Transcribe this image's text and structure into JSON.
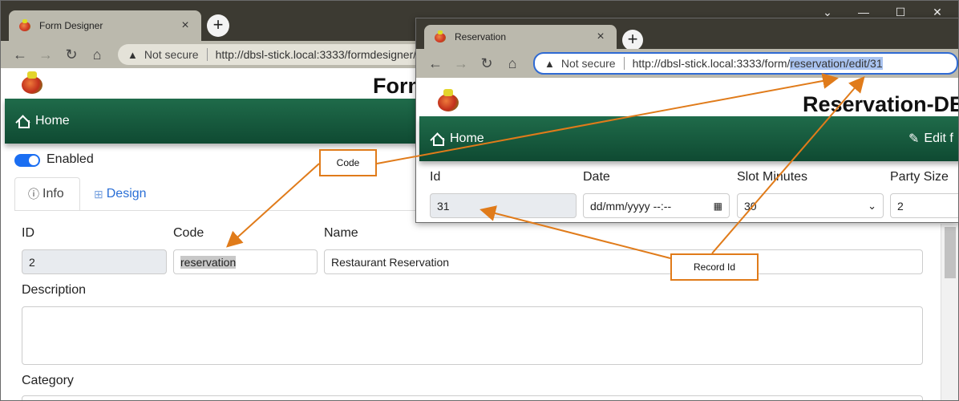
{
  "window1": {
    "tab_title": "Form Designer",
    "not_secure": "Not secure",
    "url": "http://dbsl-stick.local:3333/formdesigner/",
    "page_title": "Form",
    "home": "Home",
    "enabled": "Enabled",
    "tabs": [
      "Info",
      "Design"
    ],
    "labels": {
      "id": "ID",
      "code": "Code",
      "name": "Name",
      "description": "Description",
      "category": "Category"
    },
    "values": {
      "id": "2",
      "code": "reservation",
      "name": "Restaurant Reservation"
    }
  },
  "window2": {
    "tab_title": "Reservation",
    "not_secure": "Not secure",
    "url_prefix": "http://dbsl-stick.local:3333/form/",
    "url_selected": "reservation/edit/31",
    "page_title": "Reservation-DE",
    "home": "Home",
    "edit": "Edit f",
    "labels": {
      "id": "Id",
      "date": "Date",
      "slot_minutes": "Slot Minutes",
      "party_size": "Party Size"
    },
    "values": {
      "id": "31",
      "date": "dd/mm/yyyy --:--",
      "slot_minutes": "30",
      "party_size": "2"
    }
  },
  "annotations": {
    "code": "Code",
    "record_id": "Record Id"
  },
  "colors": {
    "navbar": "#1a5c40",
    "callout": "#e07b1a",
    "link": "#2a6fd6",
    "toggle": "#1a6ef2"
  }
}
